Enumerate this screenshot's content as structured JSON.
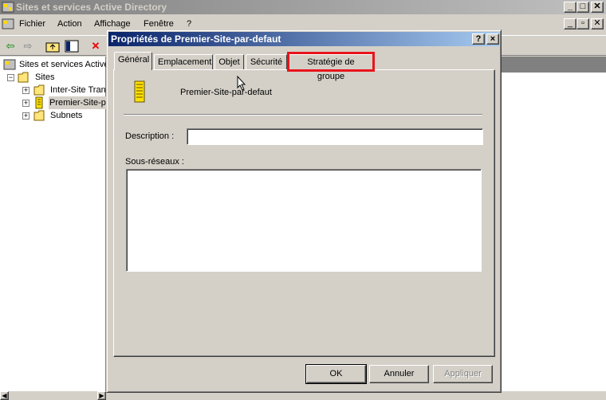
{
  "main_window": {
    "title": "Sites et services Active Directory",
    "menus": [
      "Fichier",
      "Action",
      "Affichage",
      "Fenêtre",
      "?"
    ],
    "tree": {
      "root": "Sites et services Active",
      "sites": "Sites",
      "children": [
        "Inter-Site Tran",
        "Premier-Site-p",
        "Subnets"
      ]
    }
  },
  "dialog": {
    "title": "Propriétés de Premier-Site-par-defaut",
    "tabs": [
      "Général",
      "Emplacement",
      "Objet",
      "Sécurité",
      "Stratégie de groupe"
    ],
    "active_tab": "Général",
    "highlighted_tab": "Stratégie de groupe",
    "site_name": "Premier-Site-par-defaut",
    "description_label": "Description :",
    "description_value": "",
    "subnets_label": "Sous-réseaux :",
    "buttons": {
      "ok": "OK",
      "cancel": "Annuler",
      "apply": "Appliquer"
    },
    "help_button": "?",
    "close_button": "×"
  },
  "colors": {
    "highlight": "#e8141c",
    "title_active": "#0a246a",
    "title_inactive": "#808080"
  }
}
